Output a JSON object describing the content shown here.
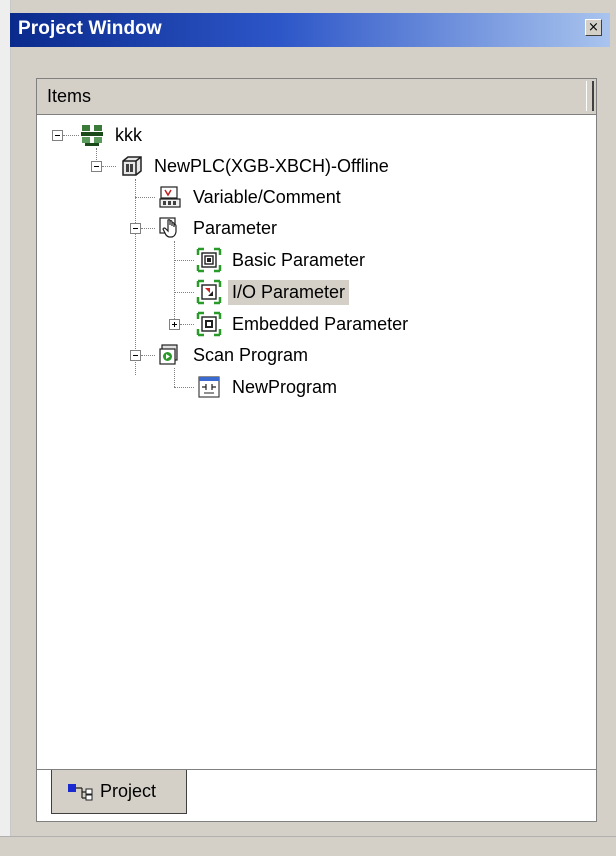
{
  "window": {
    "title": "Project Window",
    "close_symbol": "×"
  },
  "header": {
    "items_label": "Items"
  },
  "tree": {
    "nodes": [
      {
        "label": "kkk",
        "icon": "project-icon",
        "expander": "minus"
      },
      {
        "label": "NewPLC(XGB-XBCH)-Offline",
        "icon": "plc-icon",
        "expander": "minus"
      },
      {
        "label": "Variable/Comment",
        "icon": "variable-comment-icon",
        "expander": "none"
      },
      {
        "label": "Parameter",
        "icon": "parameter-hand-icon",
        "expander": "minus"
      },
      {
        "label": "Basic Parameter",
        "icon": "basic-parameter-icon",
        "expander": "none"
      },
      {
        "label": "I/O Parameter",
        "icon": "io-parameter-icon",
        "expander": "none",
        "selected": true
      },
      {
        "label": "Embedded Parameter",
        "icon": "embedded-parameter-icon",
        "expander": "plus"
      },
      {
        "label": "Scan Program",
        "icon": "scan-program-icon",
        "expander": "minus"
      },
      {
        "label": "NewProgram",
        "icon": "program-icon",
        "expander": "none"
      }
    ]
  },
  "tabs": [
    {
      "label": "Project",
      "icon": "project-tree-icon",
      "active": true
    }
  ],
  "colors": {
    "title_start": "#0a2a8c",
    "title_end": "#a9c4ee",
    "chrome": "#d4d0c8",
    "selection": "#d4d0c8"
  }
}
